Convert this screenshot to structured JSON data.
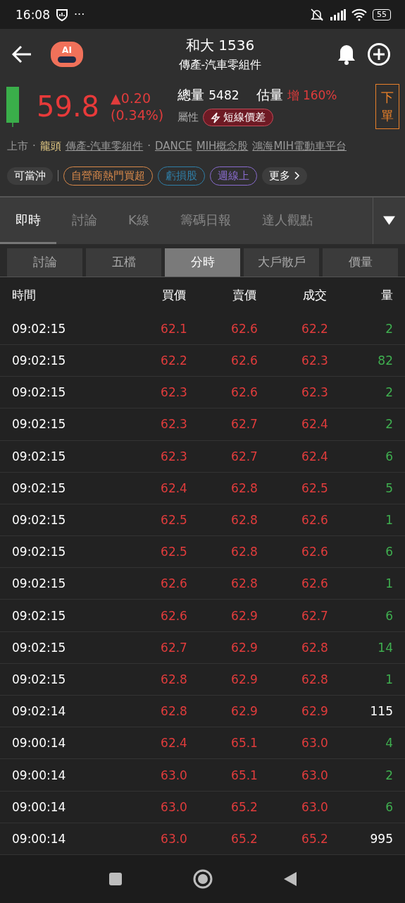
{
  "status_bar": {
    "time": "16:08",
    "dots": "···",
    "battery": "55"
  },
  "header": {
    "title": "和大 1536",
    "subtitle": "傳產-汽車零組件",
    "ai_badge": "AI"
  },
  "quote": {
    "price": "59.8",
    "change": "▲0.20",
    "change_pct": "(0.34%)",
    "volume_label": "總量",
    "volume": "5482",
    "estimate_label": "估量",
    "estimate_value": "增 160%",
    "attr_label": "屬性",
    "attr_tag": "短線價差",
    "order_button": "下單"
  },
  "tags": [
    {
      "text": "上市",
      "kind": "plain"
    },
    {
      "text": "·",
      "kind": "plain"
    },
    {
      "text": "龍頭",
      "kind": "highlight"
    },
    {
      "text": "傳產-汽車零組件",
      "kind": "link"
    },
    {
      "text": "·",
      "kind": "plain"
    },
    {
      "text": "DANCE",
      "kind": "link"
    },
    {
      "text": "MIH概念股",
      "kind": "link"
    },
    {
      "text": "鴻海MIH電動車平台",
      "kind": "link"
    }
  ],
  "chips": [
    {
      "text": "可當沖",
      "kind": "filled"
    },
    {
      "text": "自營商熱門買超",
      "kind": "outline",
      "color": "#d9894a"
    },
    {
      "text": "虧損股",
      "kind": "outline",
      "color": "#2f7fa8"
    },
    {
      "text": "週線上",
      "kind": "outline",
      "color": "#8a6ccf"
    },
    {
      "text": "更多",
      "kind": "more"
    }
  ],
  "tabs": [
    {
      "label": "即時",
      "selected": true
    },
    {
      "label": "討論",
      "selected": false
    },
    {
      "label": "K線",
      "selected": false
    },
    {
      "label": "籌碼日報",
      "selected": false
    },
    {
      "label": "達人觀點",
      "selected": false
    }
  ],
  "subtabs": [
    {
      "label": "討論",
      "selected": false
    },
    {
      "label": "五檔",
      "selected": false
    },
    {
      "label": "分時",
      "selected": true
    },
    {
      "label": "大戶散戶",
      "selected": false
    },
    {
      "label": "價量",
      "selected": false
    }
  ],
  "table": {
    "columns": [
      "時間",
      "買價",
      "賣價",
      "成交",
      "量"
    ],
    "rows": [
      {
        "time": "09:02:15",
        "bid": "62.1",
        "ask": "62.6",
        "deal": "62.2",
        "vol": "2",
        "color": "#3fae4f"
      },
      {
        "time": "09:02:15",
        "bid": "62.2",
        "ask": "62.6",
        "deal": "62.3",
        "vol": "82",
        "color": "#3fae4f"
      },
      {
        "time": "09:02:15",
        "bid": "62.3",
        "ask": "62.6",
        "deal": "62.3",
        "vol": "2",
        "color": "#3fae4f"
      },
      {
        "time": "09:02:15",
        "bid": "62.3",
        "ask": "62.7",
        "deal": "62.4",
        "vol": "2",
        "color": "#3fae4f"
      },
      {
        "time": "09:02:15",
        "bid": "62.3",
        "ask": "62.7",
        "deal": "62.4",
        "vol": "6",
        "color": "#3fae4f"
      },
      {
        "time": "09:02:15",
        "bid": "62.4",
        "ask": "62.8",
        "deal": "62.5",
        "vol": "5",
        "color": "#3fae4f"
      },
      {
        "time": "09:02:15",
        "bid": "62.5",
        "ask": "62.8",
        "deal": "62.6",
        "vol": "1",
        "color": "#3fae4f"
      },
      {
        "time": "09:02:15",
        "bid": "62.5",
        "ask": "62.8",
        "deal": "62.6",
        "vol": "6",
        "color": "#3fae4f"
      },
      {
        "time": "09:02:15",
        "bid": "62.6",
        "ask": "62.8",
        "deal": "62.6",
        "vol": "1",
        "color": "#3fae4f"
      },
      {
        "time": "09:02:15",
        "bid": "62.6",
        "ask": "62.9",
        "deal": "62.7",
        "vol": "6",
        "color": "#3fae4f"
      },
      {
        "time": "09:02:15",
        "bid": "62.7",
        "ask": "62.9",
        "deal": "62.8",
        "vol": "14",
        "color": "#3fae4f"
      },
      {
        "time": "09:02:15",
        "bid": "62.8",
        "ask": "62.9",
        "deal": "62.8",
        "vol": "1",
        "color": "#3fae4f"
      },
      {
        "time": "09:02:14",
        "bid": "62.8",
        "ask": "62.9",
        "deal": "62.9",
        "vol": "115",
        "color": "#ffffff"
      },
      {
        "time": "09:00:14",
        "bid": "62.4",
        "ask": "65.1",
        "deal": "63.0",
        "vol": "4",
        "color": "#3fae4f"
      },
      {
        "time": "09:00:14",
        "bid": "63.0",
        "ask": "65.1",
        "deal": "63.0",
        "vol": "2",
        "color": "#3fae4f"
      },
      {
        "time": "09:00:14",
        "bid": "63.0",
        "ask": "65.2",
        "deal": "63.0",
        "vol": "6",
        "color": "#3fae4f"
      },
      {
        "time": "09:00:14",
        "bid": "63.0",
        "ask": "65.2",
        "deal": "65.2",
        "vol": "995",
        "color": "#ffffff"
      }
    ]
  }
}
